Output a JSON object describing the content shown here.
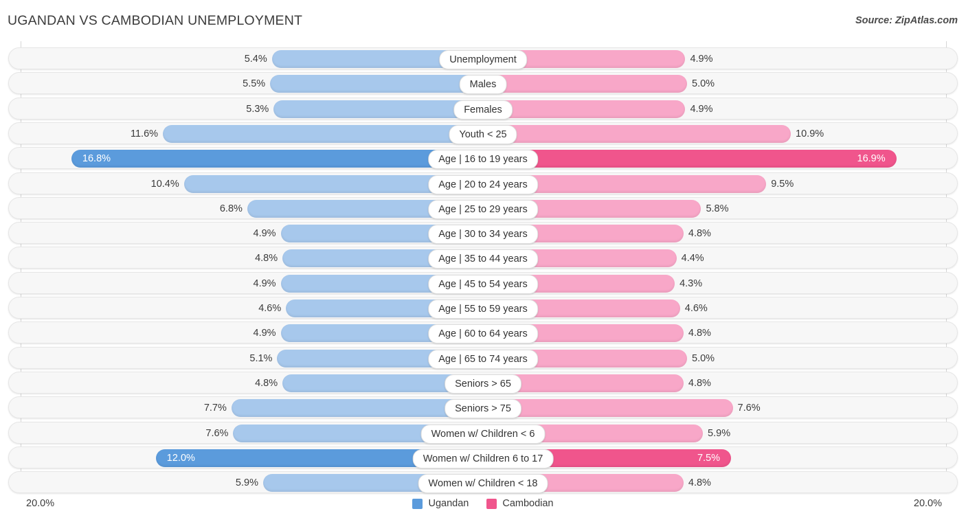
{
  "header": {
    "title": "UGANDAN VS CAMBODIAN UNEMPLOYMENT",
    "source": "Source: ZipAtlas.com"
  },
  "axis": {
    "min_label": "20.0%",
    "max_label": "20.0%"
  },
  "legend": {
    "items": [
      {
        "label": "Ugandan",
        "color": "#5b9bdc"
      },
      {
        "label": "Cambodian",
        "color": "#f0558c"
      }
    ]
  },
  "colors": {
    "ugandan_light": "#a7c8ec",
    "ugandan_dark": "#5b9bdc",
    "cambodian_light": "#f8a7c8",
    "cambodian_dark": "#f0558c",
    "track": "#f7f7f7",
    "gridline": "#d6d6d6"
  },
  "chart_data": {
    "type": "bar",
    "title": "UGANDAN VS CAMBODIAN UNEMPLOYMENT",
    "subtitle": "",
    "orientation": "horizontal-diverging",
    "xlabel": "",
    "ylabel": "",
    "xlim": [
      20.0,
      20.0
    ],
    "grid": true,
    "legend_position": "bottom-center",
    "categories": [
      "Unemployment",
      "Males",
      "Females",
      "Youth < 25",
      "Age | 16 to 19 years",
      "Age | 20 to 24 years",
      "Age | 25 to 29 years",
      "Age | 30 to 34 years",
      "Age | 35 to 44 years",
      "Age | 45 to 54 years",
      "Age | 55 to 59 years",
      "Age | 60 to 64 years",
      "Age | 65 to 74 years",
      "Seniors > 65",
      "Seniors > 75",
      "Women w/ Children < 6",
      "Women w/ Children 6 to 17",
      "Women w/ Children < 18"
    ],
    "series": [
      {
        "name": "Ugandan",
        "values": [
          5.4,
          5.5,
          5.3,
          11.6,
          16.8,
          10.4,
          6.8,
          4.9,
          4.8,
          4.9,
          4.6,
          4.9,
          5.1,
          4.8,
          7.7,
          7.6,
          12.0,
          5.9
        ],
        "labels": [
          "5.4%",
          "5.5%",
          "5.3%",
          "11.6%",
          "16.8%",
          "10.4%",
          "6.8%",
          "4.9%",
          "4.8%",
          "4.9%",
          "4.6%",
          "4.9%",
          "5.1%",
          "4.8%",
          "7.7%",
          "7.6%",
          "12.0%",
          "5.9%"
        ]
      },
      {
        "name": "Cambodian",
        "values": [
          4.9,
          5.0,
          4.9,
          10.9,
          16.9,
          9.5,
          5.8,
          4.8,
          4.4,
          4.3,
          4.6,
          4.8,
          5.0,
          4.8,
          7.6,
          5.9,
          7.5,
          4.8
        ],
        "labels": [
          "4.9%",
          "5.0%",
          "4.9%",
          "10.9%",
          "16.9%",
          "9.5%",
          "5.8%",
          "4.8%",
          "4.4%",
          "4.3%",
          "4.6%",
          "4.8%",
          "5.0%",
          "4.8%",
          "7.6%",
          "5.9%",
          "7.5%",
          "4.8%"
        ]
      }
    ],
    "highlighted_rows": [
      4,
      16
    ],
    "inside_label_rows": [
      4,
      16
    ]
  }
}
